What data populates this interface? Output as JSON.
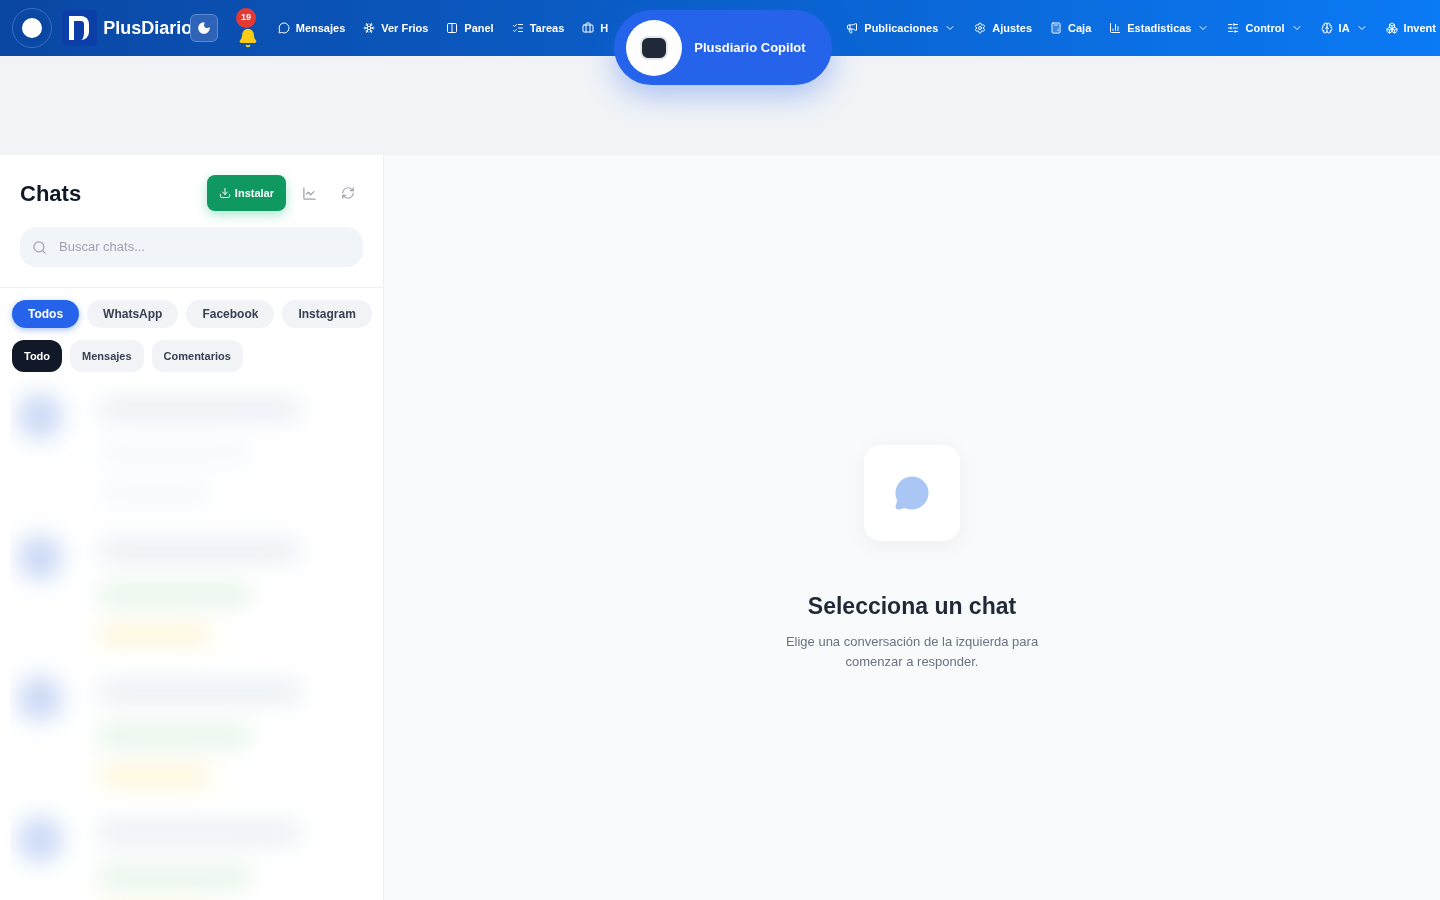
{
  "topbar": {
    "brand": "PlusDiario",
    "notifications": "19",
    "nav_left": [
      {
        "label": "Mensajes",
        "dropdown": false
      },
      {
        "label": "Ver Frios",
        "dropdown": false
      },
      {
        "label": "Panel",
        "dropdown": false
      },
      {
        "label": "Tareas",
        "dropdown": false
      },
      {
        "label": "H",
        "dropdown": false
      }
    ],
    "nav_right": [
      {
        "label": "Publicaciones",
        "dropdown": true
      },
      {
        "label": "Ajustes",
        "dropdown": false
      },
      {
        "label": "Caja",
        "dropdown": false
      },
      {
        "label": "Estadisticas",
        "dropdown": true
      },
      {
        "label": "Control",
        "dropdown": true
      },
      {
        "label": "IA",
        "dropdown": true
      },
      {
        "label": "Invent",
        "dropdown": false
      }
    ],
    "copilot": "Plusdiario Copilot"
  },
  "sidebar": {
    "title": "Chats",
    "install": "Instalar",
    "search": {
      "placeholder": "Buscar chats..."
    },
    "channels": [
      {
        "label": "Todos",
        "selected": true
      },
      {
        "label": "WhatsApp",
        "selected": false
      },
      {
        "label": "Facebook",
        "selected": false
      },
      {
        "label": "Instagram",
        "selected": false
      }
    ],
    "types": [
      {
        "label": "Todo",
        "selected": true
      },
      {
        "label": "Mensajes",
        "selected": false
      },
      {
        "label": "Comentarios",
        "selected": false
      }
    ]
  },
  "empty_state": {
    "title": "Selecciona un chat",
    "text": "Elige una conversación de la izquierda para comenzar a responder."
  }
}
